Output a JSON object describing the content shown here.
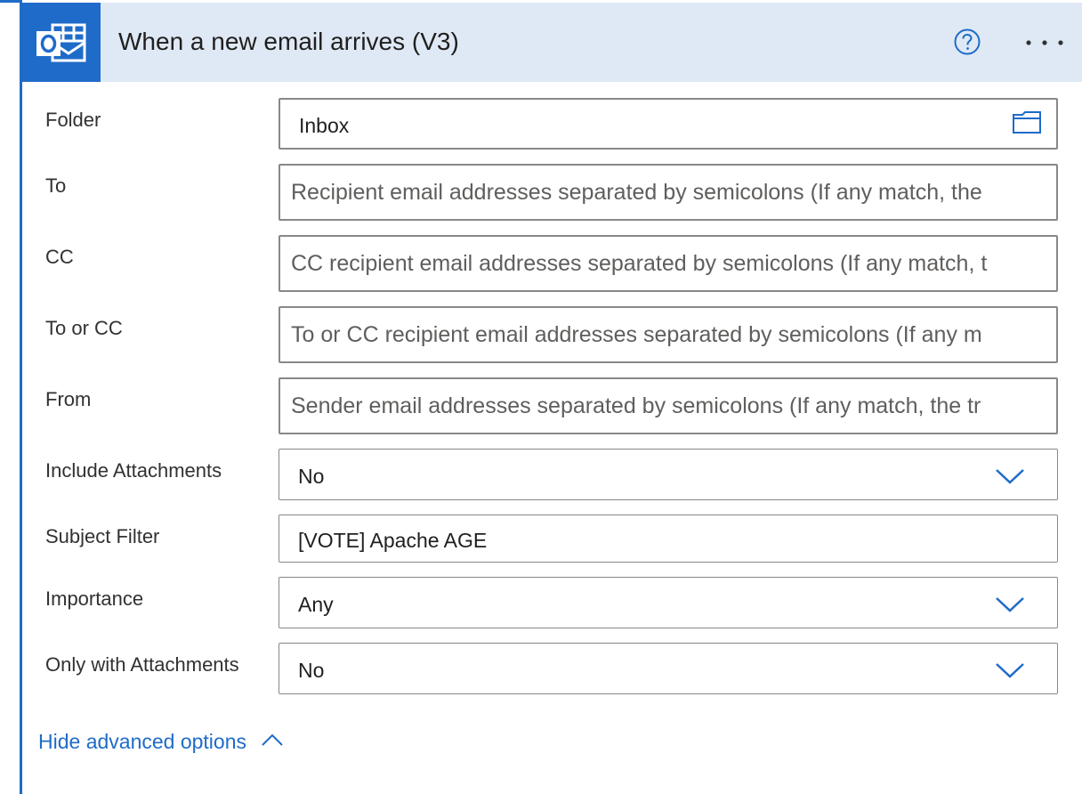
{
  "header": {
    "title": "When a new email arrives (V3)",
    "logo_icon": "outlook-icon",
    "help_icon": "help-circle-icon",
    "more_icon": "more-horizontal-icon",
    "accent_color": "#1f6bc9",
    "header_bg": "#dfe9f5"
  },
  "fields": {
    "folder": {
      "label": "Folder",
      "value": "Inbox",
      "icon": "folder-icon"
    },
    "to": {
      "label": "To",
      "placeholder": "Recipient email addresses separated by semicolons (If any match, the"
    },
    "cc": {
      "label": "CC",
      "placeholder": "CC recipient email addresses separated by semicolons (If any match, t"
    },
    "to_or_cc": {
      "label": "To or CC",
      "placeholder": "To or CC recipient email addresses separated by semicolons (If any m"
    },
    "from": {
      "label": "From",
      "placeholder": "Sender email addresses separated by semicolons (If any match, the tr"
    },
    "include_attachments": {
      "label": "Include Attachments",
      "value": "No",
      "icon": "chevron-down-icon"
    },
    "subject_filter": {
      "label": "Subject Filter",
      "value": "[VOTE] Apache AGE"
    },
    "importance": {
      "label": "Importance",
      "value": "Any",
      "icon": "chevron-down-icon"
    },
    "only_with_attachments": {
      "label": "Only with Attachments",
      "value": "No",
      "icon": "chevron-down-icon"
    }
  },
  "footer": {
    "hide_advanced_label": "Hide advanced options",
    "hide_icon": "chevron-up-icon"
  }
}
